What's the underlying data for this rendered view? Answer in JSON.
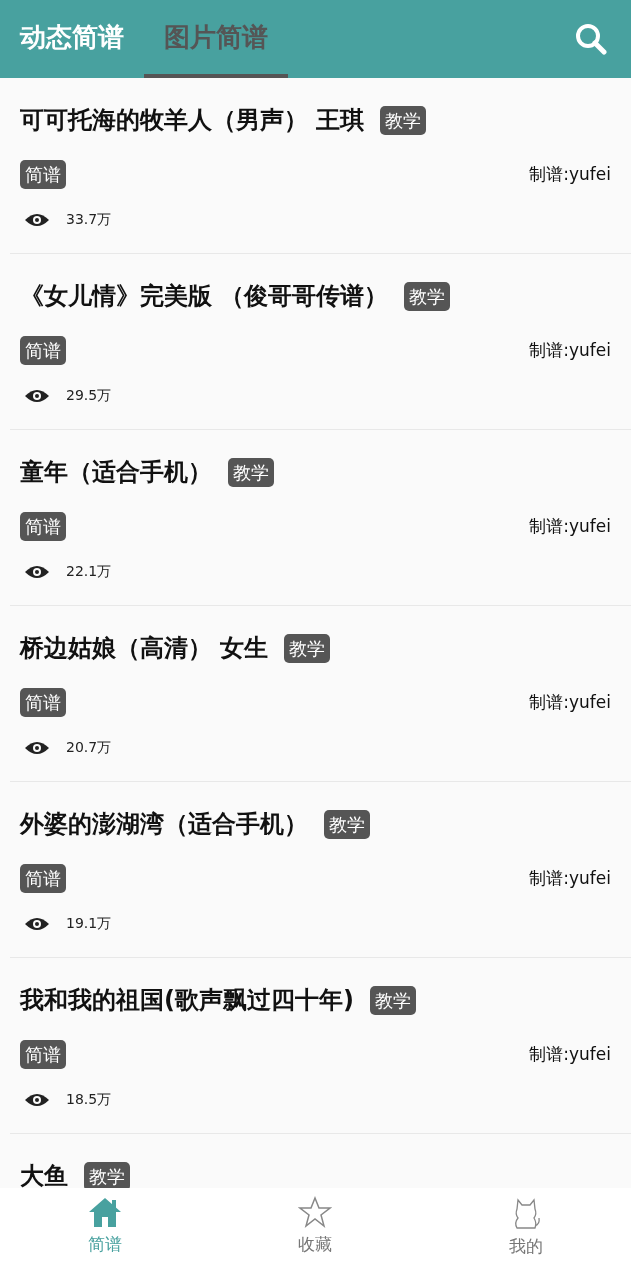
{
  "tabs": [
    {
      "label": "动态简谱",
      "selected": false
    },
    {
      "label": "图片简谱",
      "selected": true
    }
  ],
  "songs": [
    {
      "title": "可可托海的牧羊人（男声） 王琪",
      "badge": "教学",
      "tag": "简谱",
      "author": "制谱:yufei",
      "views": "33.7万"
    },
    {
      "title": "《女儿情》完美版 （俊哥哥传谱）",
      "badge": "教学",
      "tag": "简谱",
      "author": "制谱:yufei",
      "views": "29.5万"
    },
    {
      "title": "童年（适合手机）",
      "badge": "教学",
      "tag": "简谱",
      "author": "制谱:yufei",
      "views": "22.1万"
    },
    {
      "title": "桥边姑娘（高清） 女生",
      "badge": "教学",
      "tag": "简谱",
      "author": "制谱:yufei",
      "views": "20.7万"
    },
    {
      "title": "外婆的澎湖湾（适合手机）",
      "badge": "教学",
      "tag": "简谱",
      "author": "制谱:yufei",
      "views": "19.1万"
    },
    {
      "title": "我和我的祖国(歌声飘过四十年)",
      "badge": "教学",
      "tag": "简谱",
      "author": "制谱:yufei",
      "views": "18.5万"
    },
    {
      "title": "大鱼",
      "badge": "教学"
    }
  ],
  "bottom_nav": [
    {
      "kind": "home",
      "label": "简谱",
      "selected": true
    },
    {
      "kind": "star",
      "label": "收藏",
      "selected": false
    },
    {
      "kind": "cat",
      "label": "我的",
      "selected": false
    }
  ]
}
